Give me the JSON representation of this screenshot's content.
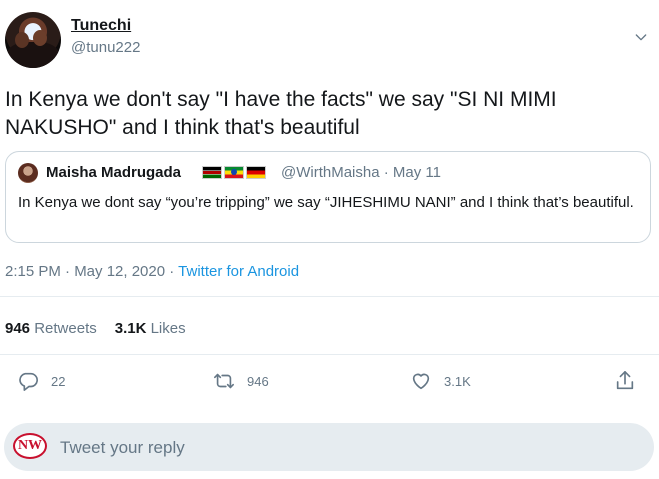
{
  "author": {
    "name": "Tunechi",
    "handle": "@tunu222"
  },
  "tweet": {
    "text": "In Kenya we don't say \"I have the facts\" we say \"SI NI MIMI NAKUSHO\" and I think that's beautiful"
  },
  "quoted_tweet": {
    "name": "Maisha Madrugada",
    "flags": [
      "Kenya flag",
      "Ethiopia flag",
      "Germany flag"
    ],
    "meta": "@WirthMaisha · May 11",
    "text": "In Kenya we dont say “you’re tripping” we say “JIHESHIMU NANI” and I think that’s beautiful."
  },
  "timestamp": {
    "time_date": "2:15 PM · May 12, 2020 · ",
    "source": "Twitter for Android"
  },
  "stats": {
    "retweets_count": "946",
    "retweets_label": "Retweets",
    "likes_count": "3.1K",
    "likes_label": "Likes"
  },
  "actions": {
    "reply_count": "22",
    "retweet_count": "946",
    "like_count": "3.1K"
  },
  "reply": {
    "logo_text": "NW",
    "placeholder": "Tweet your reply"
  },
  "colors": {
    "link": "#1b95e0",
    "muted": "#657786",
    "text": "#14171a"
  }
}
